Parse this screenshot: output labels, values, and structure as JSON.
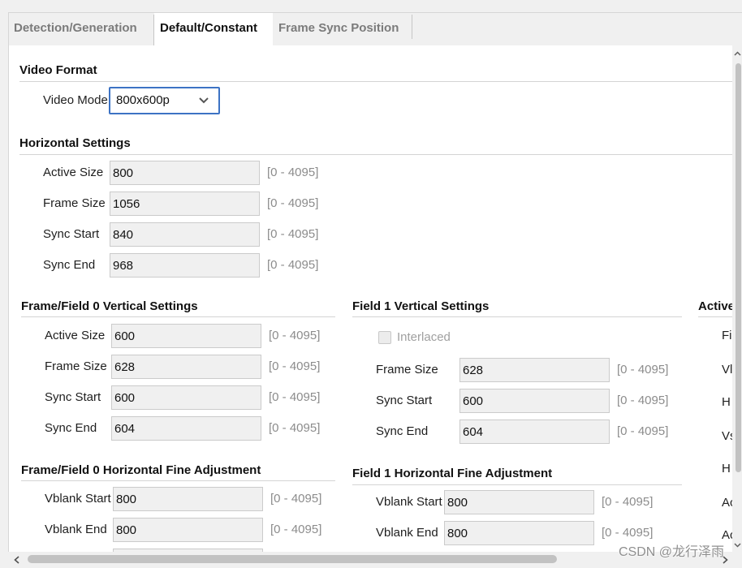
{
  "tabs": [
    {
      "label": "Detection/Generation",
      "active": false
    },
    {
      "label": "Default/Constant",
      "active": true
    },
    {
      "label": "Frame Sync Position",
      "active": false
    }
  ],
  "video_format": {
    "title": "Video Format",
    "video_mode": {
      "label": "Video Mode",
      "value": "800x600p",
      "icon": "chevron-down-icon"
    }
  },
  "horizontal_settings": {
    "title": "Horizontal Settings",
    "rows": [
      {
        "label": "Active Size",
        "value": "800",
        "range": "[0 - 4095]"
      },
      {
        "label": "Frame Size",
        "value": "1056",
        "range": "[0 - 4095]"
      },
      {
        "label": "Sync Start",
        "value": "840",
        "range": "[0 - 4095]"
      },
      {
        "label": "Sync End",
        "value": "968",
        "range": "[0 - 4095]"
      }
    ]
  },
  "field0_vertical": {
    "title": "Frame/Field 0 Vertical Settings",
    "rows": [
      {
        "label": "Active Size",
        "value": "600",
        "range": "[0 - 4095]"
      },
      {
        "label": "Frame Size",
        "value": "628",
        "range": "[0 - 4095]"
      },
      {
        "label": "Sync Start",
        "value": "600",
        "range": "[0 - 4095]"
      },
      {
        "label": "Sync End",
        "value": "604",
        "range": "[0 - 4095]"
      }
    ]
  },
  "field1_vertical": {
    "title": "Field 1 Vertical Settings",
    "interlaced": {
      "label": "Interlaced",
      "checked": false,
      "enabled": false
    },
    "rows": [
      {
        "label": "Frame Size",
        "value": "628",
        "range": "[0 - 4095]"
      },
      {
        "label": "Sync Start",
        "value": "600",
        "range": "[0 - 4095]"
      },
      {
        "label": "Sync End",
        "value": "604",
        "range": "[0 - 4095]"
      }
    ]
  },
  "active_section_partial": {
    "title": "Active",
    "labels": [
      "Fi",
      "Vl",
      "H",
      "Vs",
      "H",
      "Ac",
      "Ac"
    ]
  },
  "field0_horizontal_fine": {
    "title": "Frame/Field 0 Horizontal Fine Adjustment",
    "rows": [
      {
        "label": "Vblank Start",
        "value": "800",
        "range": "[0 - 4095]"
      },
      {
        "label": "Vblank End",
        "value": "800",
        "range": "[0 - 4095]"
      }
    ]
  },
  "field1_horizontal_fine": {
    "title": "Field 1 Horizontal Fine Adjustment",
    "rows": [
      {
        "label": "Vblank Start",
        "value": "800",
        "range": "[0 - 4095]"
      },
      {
        "label": "Vblank End",
        "value": "800",
        "range": "[0 - 4095]"
      }
    ]
  },
  "scroll": {
    "vertical": {
      "position": 0,
      "visible_fraction": 0.87
    },
    "horizontal": {
      "position": 0,
      "visible_fraction": 0.77
    }
  },
  "colors": {
    "focus_border": "#3d73c4",
    "range_text": "#8c8c8c",
    "field_background": "#f0f0f0"
  },
  "watermark": "CSDN @龙行泽雨"
}
